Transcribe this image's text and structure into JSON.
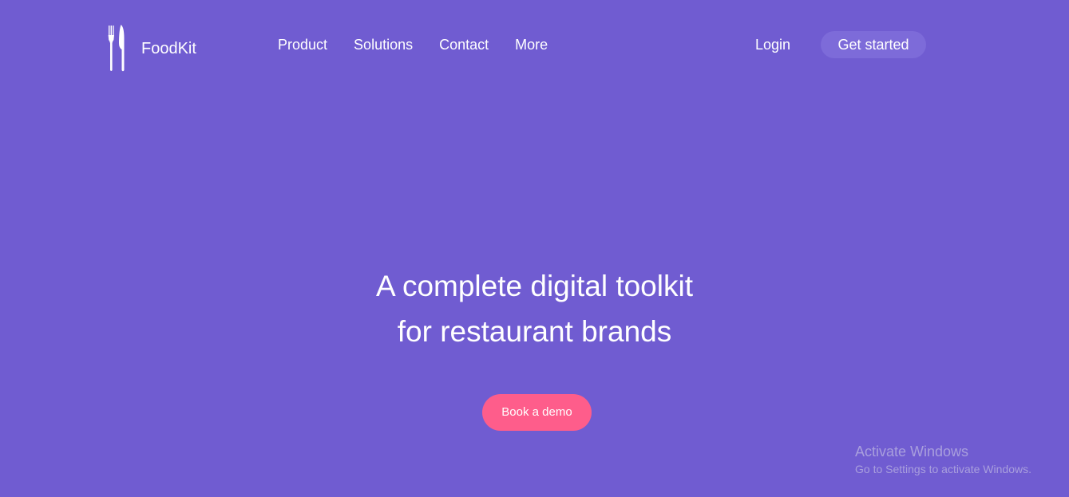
{
  "brand": {
    "name": "FoodKit",
    "icon": "fork-knife-icon"
  },
  "nav": {
    "items": [
      "Product",
      "Solutions",
      "Contact",
      "More"
    ]
  },
  "header": {
    "login_label": "Login",
    "cta_label": "Get started"
  },
  "hero": {
    "title_line1": "A complete digital toolkit",
    "title_line2": "for restaurant brands",
    "button_label": "Book a demo"
  },
  "watermark": {
    "title": "Activate Windows",
    "subtitle": "Go to Settings to activate Windows."
  },
  "colors": {
    "background": "#705cd1",
    "cta_background": "#7d6bd9",
    "demo_button": "#fe5d8b",
    "text": "#ffffff"
  }
}
